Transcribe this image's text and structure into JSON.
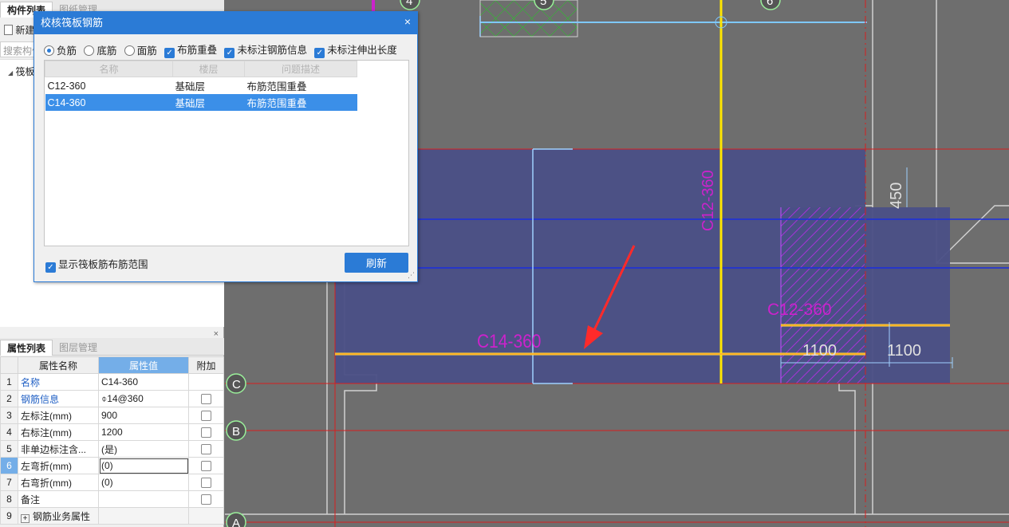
{
  "component_panel": {
    "tabs": [
      "构件列表",
      "图纸管理"
    ],
    "new_label": "新建",
    "search_placeholder": "搜索构件...",
    "tree_root": "筏板负筋"
  },
  "property_panel": {
    "tabs": [
      "属性列表",
      "图层管理"
    ],
    "headers": {
      "name": "属性名称",
      "value": "属性值",
      "extra": "附加"
    },
    "rows": [
      {
        "num": "1",
        "name": "名称",
        "value": "C14-360"
      },
      {
        "num": "2",
        "name": "钢筋信息",
        "value": "⌽14@360"
      },
      {
        "num": "3",
        "name": "左标注(mm)",
        "value": "900"
      },
      {
        "num": "4",
        "name": "右标注(mm)",
        "value": "1200"
      },
      {
        "num": "5",
        "name": "非单边标注含...",
        "value": "(是)"
      },
      {
        "num": "6",
        "name": "左弯折(mm)",
        "value": "(0)"
      },
      {
        "num": "7",
        "name": "右弯折(mm)",
        "value": "(0)"
      },
      {
        "num": "8",
        "name": "备注",
        "value": ""
      },
      {
        "num": "9",
        "name": "钢筋业务属性",
        "value": ""
      }
    ]
  },
  "dialog": {
    "title": "校核筏板钢筋",
    "close": "×",
    "options": {
      "neg": "负筋",
      "bottom": "底筋",
      "top": "面筋",
      "overlap": "布筋重叠",
      "unmarked_info": "未标注钢筋信息",
      "unmarked_ext": "未标注伸出长度"
    },
    "list_headers": [
      "名称",
      "楼层",
      "问题描述"
    ],
    "rows": [
      {
        "name": "C12-360",
        "floor": "基础层",
        "issue": "布筋范围重叠"
      },
      {
        "name": "C14-360",
        "floor": "基础层",
        "issue": "布筋范围重叠"
      }
    ],
    "show_range": "显示筏板筋布筋范围",
    "refresh": "刷新"
  },
  "canvas": {
    "axis_labels": [
      "4",
      "5",
      "6",
      "C",
      "B",
      "A"
    ],
    "dims": [
      "450",
      "1100",
      "1100"
    ],
    "rebar_labels": [
      "C14-360",
      "C12-360"
    ],
    "colors": {
      "background": "#6e6e6e",
      "slab": "#4a4f86",
      "axis_red": "#d81e1e",
      "rebar_yellow": "#ffe600",
      "label_magenta": "#cc22cc",
      "accent_blue": "#2b7bd6"
    }
  }
}
